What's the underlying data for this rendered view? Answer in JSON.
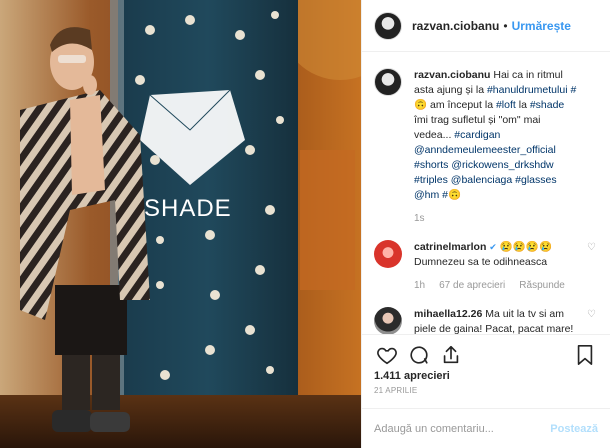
{
  "header": {
    "username": "razvan.ciobanu",
    "separator": "•",
    "follow_label": "Urmărește"
  },
  "caption": {
    "username": "razvan.ciobanu",
    "text_1": "Hai ca in ritmul asta ajung și la ",
    "tag_1": "#hanuldrumetului",
    "tag_2": "#🙃",
    "text_2": " am început la ",
    "tag_3": "#loft",
    "text_3": " la ",
    "tag_4": "#shade",
    "text_4": " îmi trag sufletul și \"om\" mai vedea... ",
    "tag_5": "#cardigan",
    "tag_6": "@anndemeulemeester_official",
    "tag_7": "#shorts",
    "tag_8": "@rickowens_drkshdw",
    "tag_9": "#triples",
    "tag_10": "@balenciaga",
    "tag_11": "#glasses",
    "tag_12": "@hm",
    "tag_13": "#🙃",
    "time": "1s"
  },
  "comments": [
    {
      "username": "catrinelmarlon",
      "verified": "✔",
      "emoji": "😢😢😢😢",
      "text": "Dumnezeu sa te odihneasca",
      "time": "1h",
      "likes": "67 de aprecieri",
      "reply": "Răspunde"
    },
    {
      "username": "mihaella12.26",
      "text": "Ma uit la tv si am piele de gaina! Pacat, pacat mare! Dumnezeu sa te odihneasca, om bun!"
    }
  ],
  "likes_count": "1.411 aprecieri",
  "post_date": "21 APRILIE",
  "add_comment": {
    "placeholder": "Adaugă un comentariu...",
    "post_label": "Postează"
  },
  "photo": {
    "banner_text": "SHADE"
  },
  "colors": {
    "link": "#3897f0",
    "tag": "#003569",
    "muted": "#999999"
  }
}
